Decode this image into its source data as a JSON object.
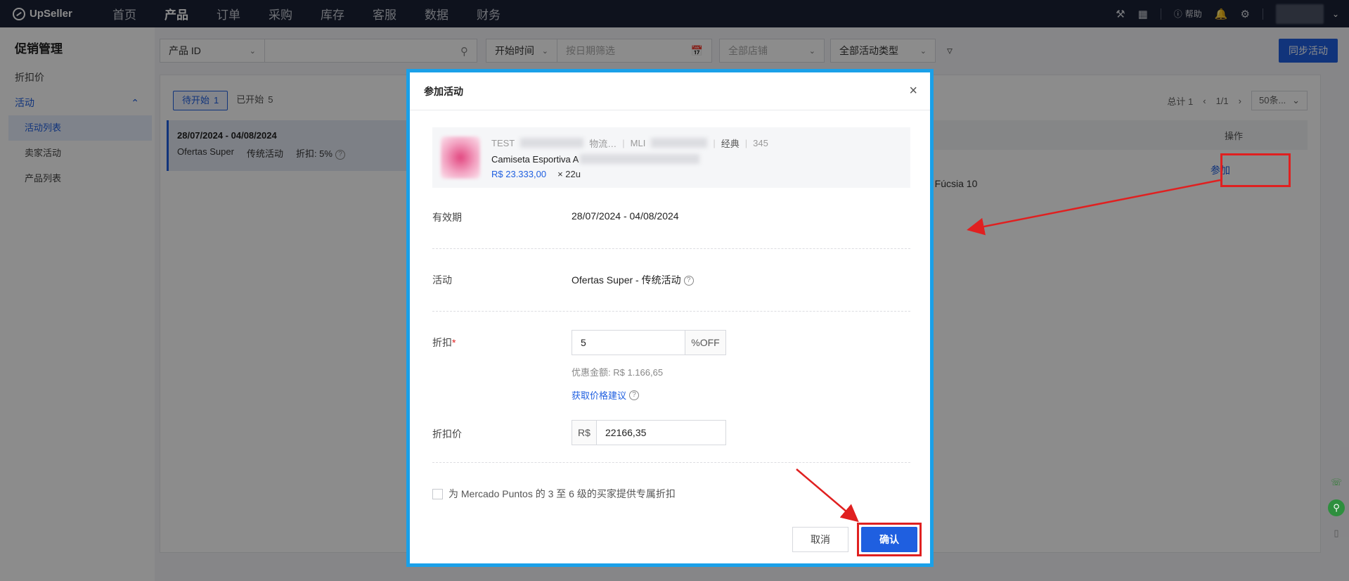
{
  "brand": {
    "name": "UpSeller"
  },
  "nav": {
    "items": [
      {
        "label": "首页",
        "active": false
      },
      {
        "label": "产品",
        "active": true
      },
      {
        "label": "订单",
        "active": false
      },
      {
        "label": "采购",
        "active": false
      },
      {
        "label": "库存",
        "active": false
      },
      {
        "label": "客服",
        "active": false
      },
      {
        "label": "数据",
        "active": false
      },
      {
        "label": "财务",
        "active": false
      }
    ],
    "help_label": "帮助"
  },
  "sidebar": {
    "title": "促销管理",
    "items": [
      {
        "label": "折扣价"
      },
      {
        "label": "活动"
      }
    ],
    "subitems": [
      {
        "label": "活动列表",
        "active": true
      },
      {
        "label": "卖家活动",
        "active": false
      },
      {
        "label": "产品列表",
        "active": false
      }
    ]
  },
  "filters": {
    "id_type": "产品 ID",
    "time_type": "开始时间",
    "date_placeholder": "按日期筛选",
    "store": "全部店铺",
    "activity_type": "全部活动类型",
    "sync_label": "同步活动"
  },
  "status_tabs": [
    {
      "label": "待开始",
      "count": "1",
      "active": true
    },
    {
      "label": "已开始",
      "count": "5",
      "active": false
    }
  ],
  "pager": {
    "total": "总计 1",
    "page": "1/1",
    "size": "50条..."
  },
  "list": {
    "date_range": "28/07/2024 - 04/08/2024",
    "name": "Ofertas Super",
    "type": "传统活动",
    "discount": "折扣: 5%"
  },
  "table": {
    "op_header": "操作",
    "join_label": "参加",
    "product_tail": "a Fúcsia 10"
  },
  "modal": {
    "title": "参加活动",
    "product": {
      "sku_prefix": "TEST",
      "logistics": "物流…",
      "mli_prefix": "MLI",
      "listing_type": "经典",
      "code": "345",
      "name": "Camiseta Esportiva A",
      "price": "R$ 23.333,00",
      "qty": "× 22u"
    },
    "validity_label": "有效期",
    "validity_value": "28/07/2024 - 04/08/2024",
    "activity_label": "活动",
    "activity_value": "Ofertas Super - 传统活动",
    "discount_label": "折扣",
    "discount_value": "5",
    "discount_suffix": "%OFF",
    "savings": "优惠金额: R$ 1.166,65",
    "price_suggest": "获取价格建议",
    "discount_price_label": "折扣价",
    "currency": "R$",
    "discount_price_value": "22166,35",
    "mercado_puntos": "为 Mercado Puntos 的 3 至 6 级的买家提供专属折扣",
    "cancel": "取消",
    "confirm": "确认"
  },
  "colors": {
    "accent": "#1f5fe0",
    "topbar": "#1b2236",
    "highlight": "#e02020",
    "modal_border": "#1aa0e8"
  }
}
